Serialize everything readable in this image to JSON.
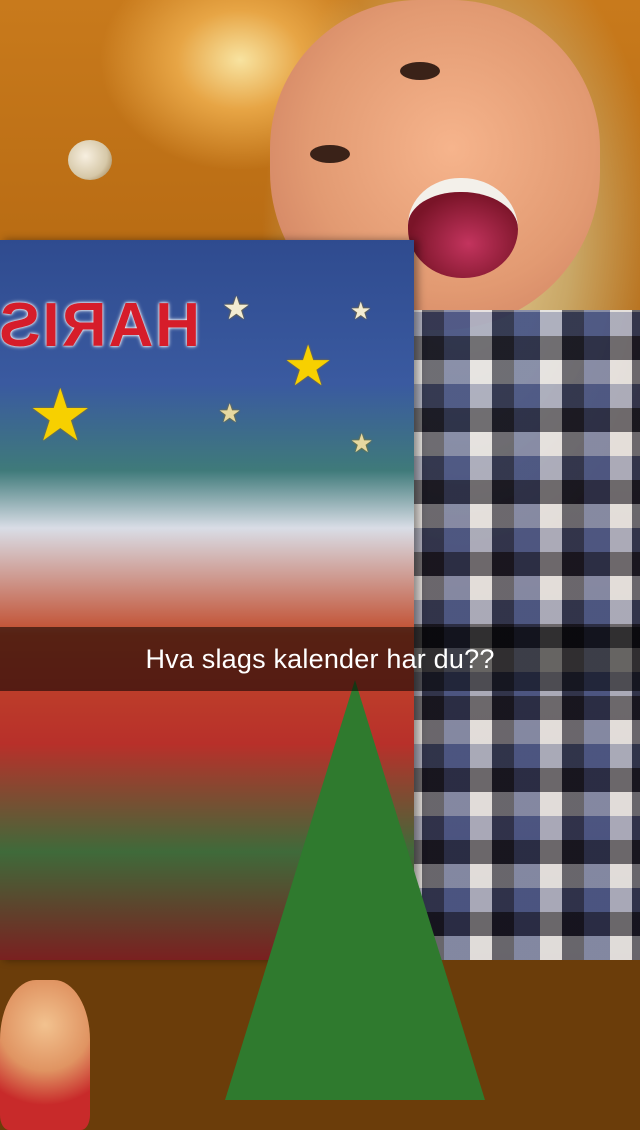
{
  "caption": {
    "text": "Hva slags kalender har du??"
  },
  "calendar": {
    "title_text": "HARIS"
  },
  "colors": {
    "caption_bar": "#000000",
    "caption_text": "#ffffff",
    "calendar_title": "#d61d2a",
    "star": "#f7d000"
  },
  "icons": {
    "stars": [
      "star-icon",
      "star-icon",
      "star-icon",
      "star-icon",
      "star-icon",
      "star-icon"
    ]
  }
}
